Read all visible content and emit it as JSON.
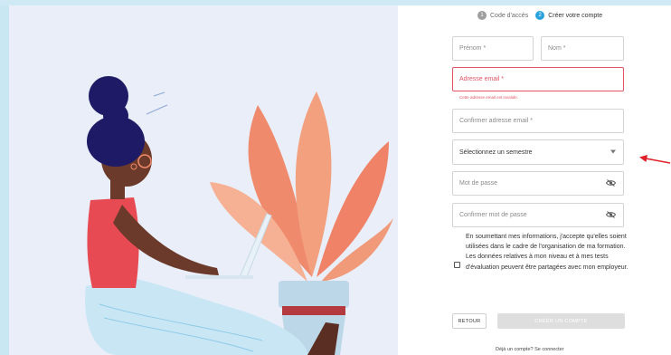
{
  "stepper": {
    "step1": {
      "number": "1",
      "label": "Code d'accès"
    },
    "step2": {
      "number": "2",
      "label": "Créer votre compte"
    }
  },
  "form": {
    "first_name": {
      "placeholder": "Prénom *"
    },
    "last_name": {
      "placeholder": "Nom *"
    },
    "email": {
      "placeholder": "Adresse email *",
      "error": "Cette adresse email est invalide."
    },
    "email_confirm": {
      "placeholder": "Confirmer adresse email *"
    },
    "semester": {
      "placeholder": "Sélectionnez un semestre"
    },
    "password": {
      "placeholder": "Mot de passe"
    },
    "password_confirm": {
      "placeholder": "Confirmer mot de passe"
    },
    "consent": {
      "text": "En soumettant mes informations, j'accepte qu'elles soient utilisées dans le cadre de l'organisation de ma formation. Les données relatives à mon niveau et à mes tests d'évaluation peuvent être partagées avec mon employeur."
    },
    "back_label": "RETOUR",
    "create_label": "CRÉER UN COMPTE"
  },
  "footer": {
    "question": "Déjà un compte?",
    "link": "Se connecter"
  },
  "colors": {
    "accent": "#2aa3dc",
    "error": "#e25564",
    "step_inactive": "#9e9e9e",
    "disabled_button": "#dedede",
    "annotation_arrow": "#e0202a"
  },
  "icons": [
    "eye-off-icon",
    "dropdown-arrow-icon",
    "annotation-arrow-icon"
  ]
}
